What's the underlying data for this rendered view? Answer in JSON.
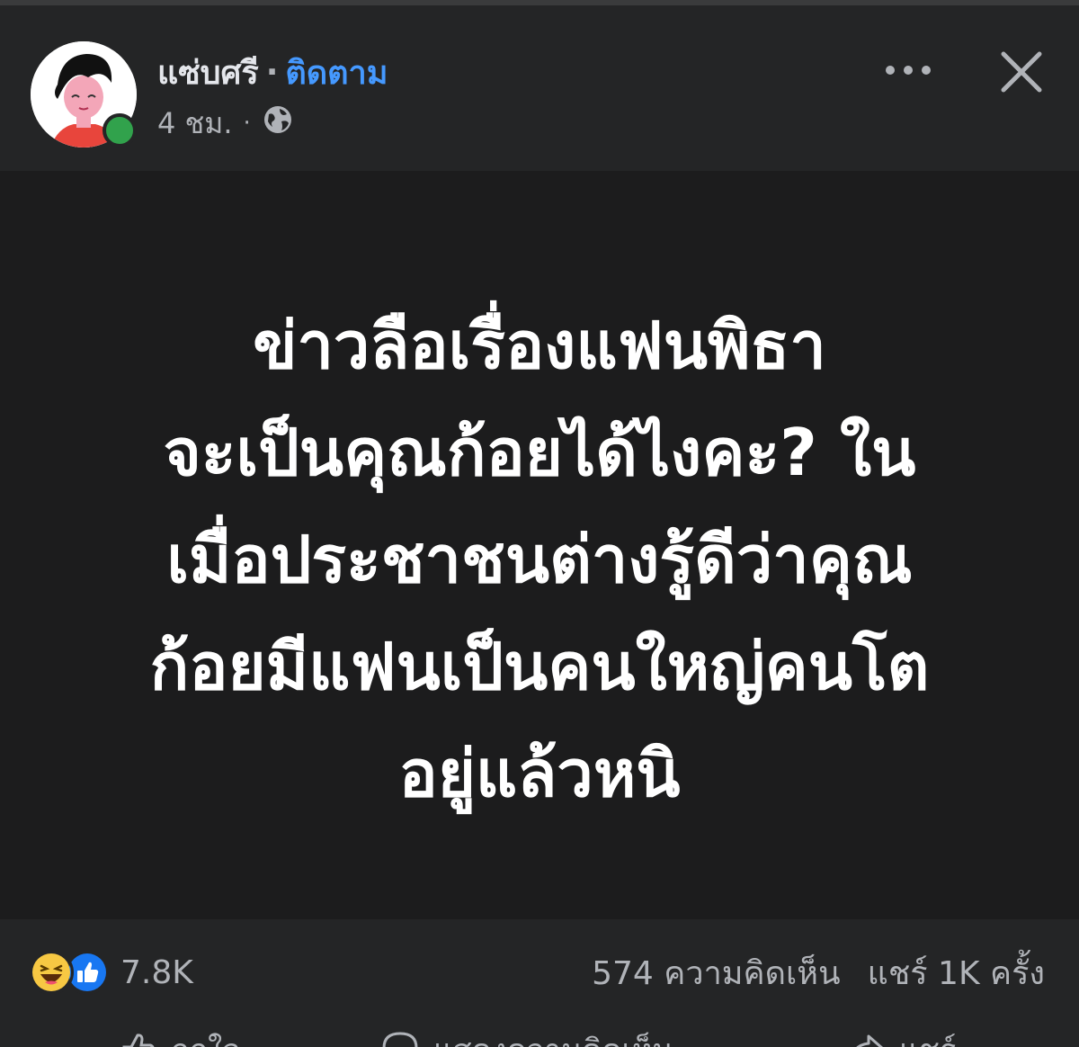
{
  "post": {
    "author": "แซ่บศรี",
    "separator": "·",
    "follow_label": "ติดตาม",
    "time": "4 ชม.",
    "meta_dot": "·",
    "privacy_icon": "globe-icon",
    "online": true
  },
  "header_actions": {
    "more_icon": "more-horizontal-icon",
    "close_icon": "close-icon"
  },
  "card": {
    "background": "#1c1c1d",
    "text": "ข่าวลือเรื่องแฟนพิธา\nจะเป็นคุณก้อยได้ไงคะ? ใน\nเมื่อประชาชนต่างรู้ดีว่าคุณ\nก้อยมีแฟนเป็นคนใหญ่คนโต\nอยู่แล้วหนิ"
  },
  "stats": {
    "reaction_icons": [
      "haha-icon",
      "like-icon"
    ],
    "reactions_count": "7.8K",
    "comments": "574 ความคิดเห็น",
    "shares": "แชร์ 1K ครั้ง"
  },
  "actions": {
    "like_label": "ถูกใจ",
    "comment_label": "แสดงความคิดเห็น",
    "share_label": "แชร์"
  },
  "colors": {
    "background": "#242526",
    "link": "#4599ff",
    "online": "#31a24c",
    "like_blue": "#1877f2",
    "haha_yellow": "#f7c843"
  }
}
